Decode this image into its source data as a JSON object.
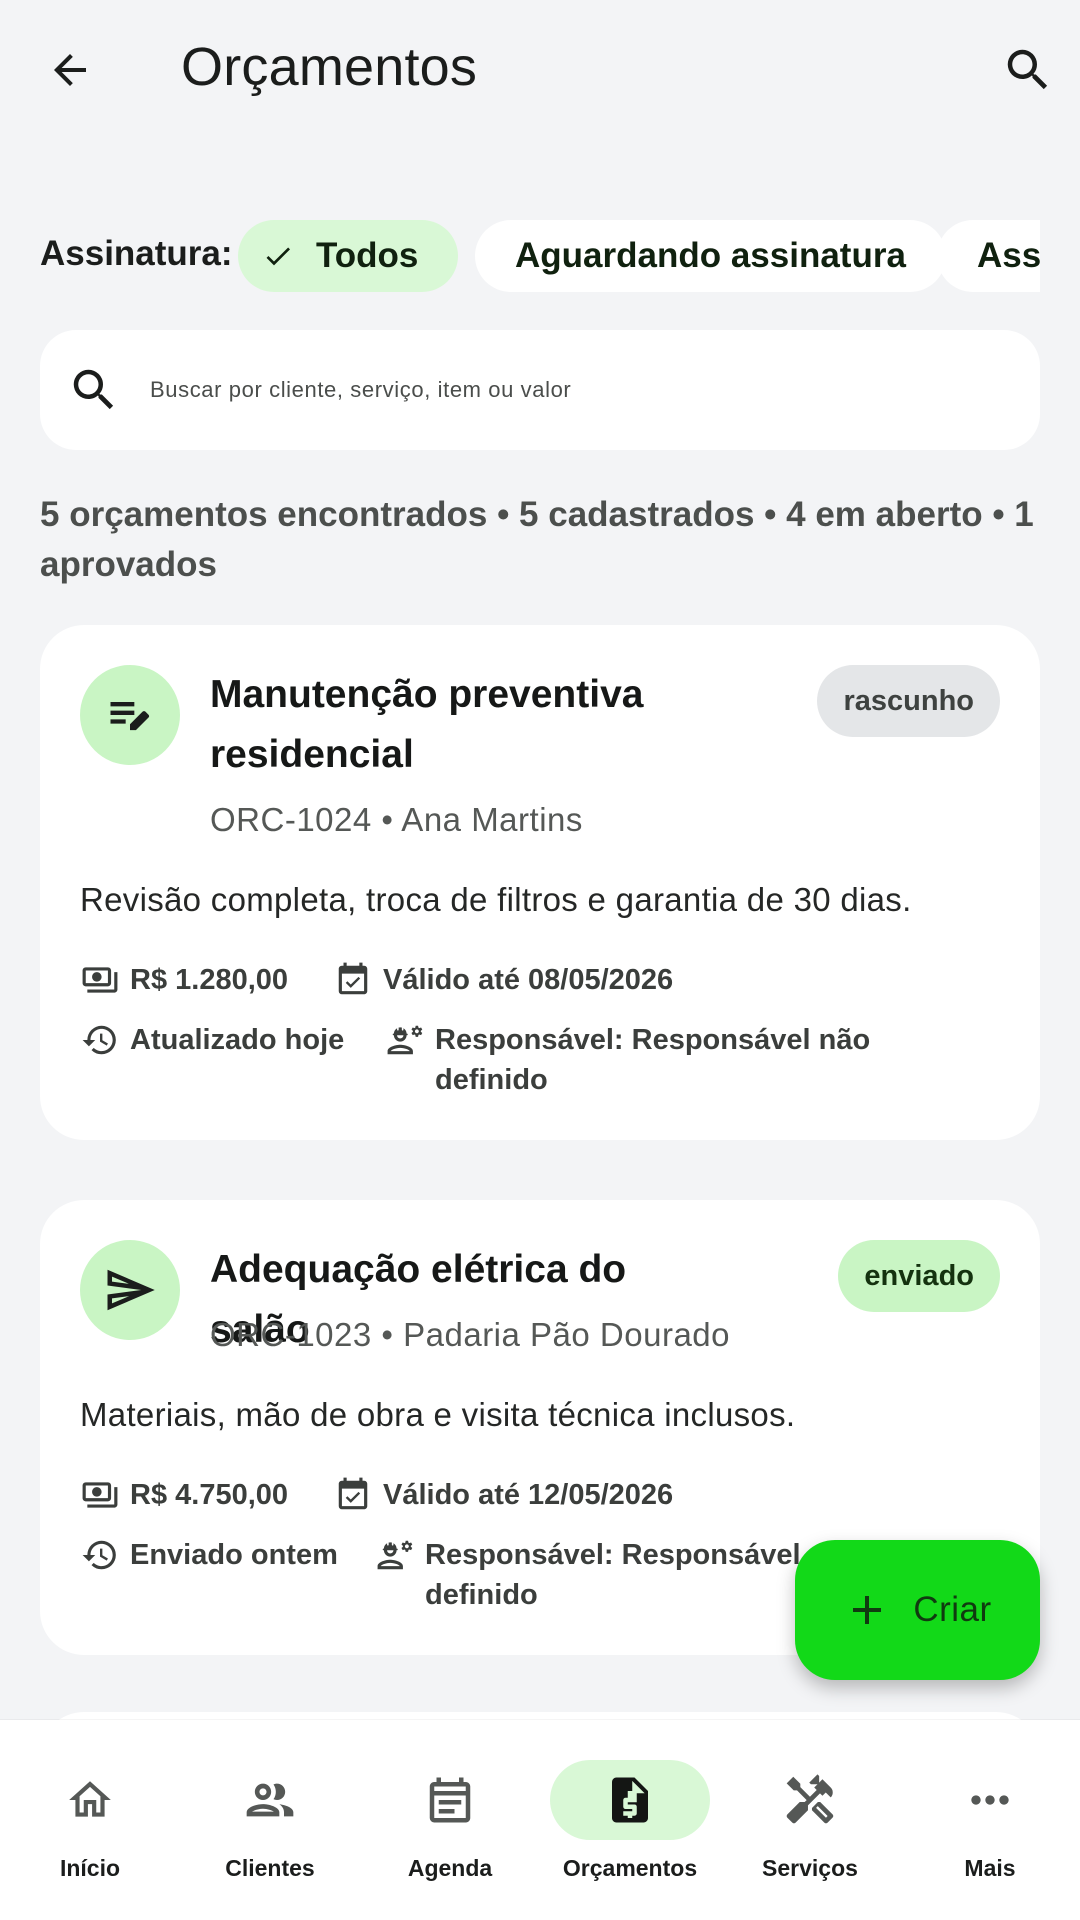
{
  "header": {
    "title": "Orçamentos"
  },
  "filters": {
    "label": "Assinatura:",
    "chips": [
      {
        "label": "Todos",
        "selected": true
      },
      {
        "label": "Aguardando assinatura",
        "selected": false
      },
      {
        "label": "Assi",
        "selected": false
      }
    ]
  },
  "search": {
    "placeholder": "Buscar por cliente, serviço, item ou valor",
    "value": ""
  },
  "summary": "5 orçamentos encontrados • 5 cadastrados • 4 em aberto • 1 aprovados",
  "quotes": [
    {
      "title": "Manutenção preventiva residencial",
      "subtitle": "ORC-1024 • Ana Martins",
      "status": "rascunho",
      "description": "Revisão completa, troca de filtros e garantia de 30 dias.",
      "value": "R$ 1.280,00",
      "valid_until": "Válido até 08/05/2026",
      "updated": "Atualizado hoje",
      "responsible": "Responsável: Responsável não definido",
      "icon": "draft-edit-icon"
    },
    {
      "title": "Adequação elétrica do salão",
      "subtitle": "ORC-1023 • Padaria Pão Dourado",
      "status": "enviado",
      "description": "Materiais, mão de obra e visita técnica inclusos.",
      "value": "R$ 4.750,00",
      "valid_until": "Válido até 12/05/2026",
      "updated": "Enviado ontem",
      "responsible": "Responsável: Responsável não definido",
      "icon": "send-icon"
    }
  ],
  "fab": {
    "label": "Criar"
  },
  "bottom_nav": [
    {
      "label": "Início",
      "icon": "home-icon",
      "active": false
    },
    {
      "label": "Clientes",
      "icon": "people-icon",
      "active": false
    },
    {
      "label": "Agenda",
      "icon": "calendar-icon",
      "active": false
    },
    {
      "label": "Orçamentos",
      "icon": "invoice-icon",
      "active": true
    },
    {
      "label": "Serviços",
      "icon": "tools-icon",
      "active": false
    },
    {
      "label": "Mais",
      "icon": "more-icon",
      "active": false
    }
  ],
  "colors": {
    "background": "#f3f4f6",
    "accent": "#12d918",
    "chip_selected": "#d9f8d6",
    "badge_sent": "#c9f5c4",
    "badge_draft": "#e4e6e8"
  }
}
